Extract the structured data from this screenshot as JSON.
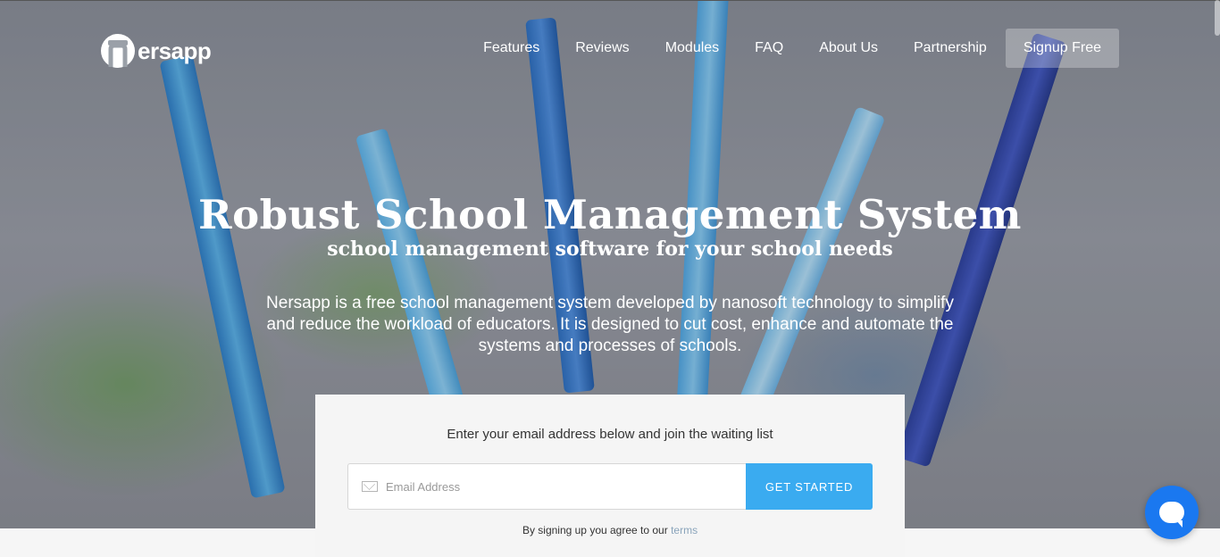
{
  "brand": {
    "name": "ersapp",
    "logo_icon": "n-logo-icon"
  },
  "nav": {
    "items": [
      {
        "label": "Features"
      },
      {
        "label": "Reviews"
      },
      {
        "label": "Modules"
      },
      {
        "label": "FAQ"
      },
      {
        "label": "About Us"
      },
      {
        "label": "Partnership"
      }
    ],
    "cta_label": "Signup Free"
  },
  "hero": {
    "title": "Robust School Management System",
    "subtitle": "school management software for your school needs",
    "description": "Nersapp is a free school management system developed by nanosoft technology to simplify and reduce the workload of educators. It is designed to cut cost, enhance and automate the systems and processes of schools."
  },
  "signup": {
    "prompt": "Enter your email address below and join the waiting list",
    "email_placeholder": "Email Address",
    "email_icon": "mail-icon",
    "button_label": "GET STARTED",
    "terms_prefix": "By signing up you agree to our",
    "terms_link": "terms"
  },
  "chat": {
    "icon": "chat-icon"
  },
  "colors": {
    "accent": "#3aabf0",
    "chat": "#1a78f0",
    "card": "#f5f5f5"
  }
}
